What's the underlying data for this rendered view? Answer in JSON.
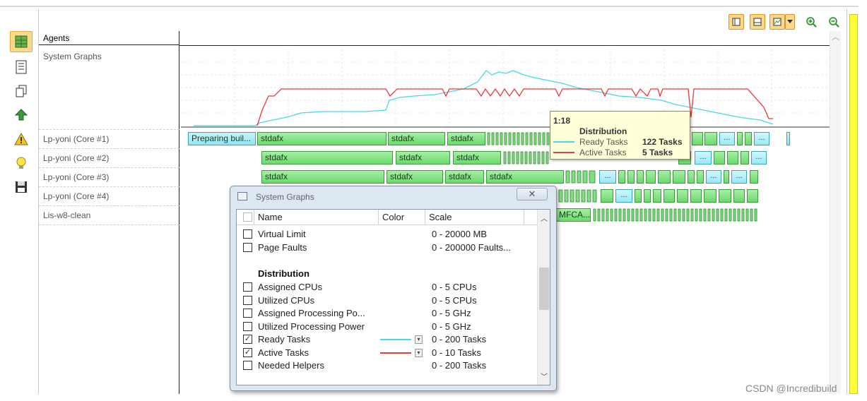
{
  "agents_header": "Agents",
  "rows": [
    {
      "name": "System Graphs"
    },
    {
      "name": "Lp-yoni (Core #1)"
    },
    {
      "name": "Lp-yoni (Core #2)"
    },
    {
      "name": "Lp-yoni (Core #3)"
    },
    {
      "name": "Lp-yoni (Core #4)"
    },
    {
      "name": "Lis-w8-clean"
    }
  ],
  "tasks": {
    "core1": {
      "first": "Preparing buil...",
      "a": "stdafx",
      "b": "stdafx",
      "c": "stdafx"
    },
    "core2": {
      "a": "stdafx",
      "b": "stdafx",
      "c": "stdafx"
    },
    "core3": {
      "a": "stdafx",
      "b": "stdafx",
      "c": "stdafx",
      "d": "stdafx"
    },
    "lis": {
      "a": "MFCA..."
    },
    "dots": "..."
  },
  "tooltip": {
    "time": "1:18",
    "title": "Distribution",
    "rows": [
      {
        "label": "Ready Tasks",
        "value": "122 Tasks",
        "color": "#45d8e8"
      },
      {
        "label": "Active Tasks",
        "value": "5 Tasks",
        "color": "#e83a3a"
      }
    ]
  },
  "dialog": {
    "title": "System Graphs",
    "close": "✕",
    "columns": {
      "name": "Name",
      "color": "Color",
      "scale": "Scale"
    },
    "rows": [
      {
        "name": "Virtual Limit",
        "scale": "0 - 20000 MB",
        "checked": false
      },
      {
        "name": "Page Faults",
        "scale": "0 - 200000 Faults...",
        "checked": false
      },
      {
        "section": "Distribution"
      },
      {
        "name": "Assigned CPUs",
        "scale": "0 - 5 CPUs",
        "checked": false
      },
      {
        "name": "Utilized CPUs",
        "scale": "0 - 5 CPUs",
        "checked": false
      },
      {
        "name": "Assigned Processing Po...",
        "scale": "0 - 5 GHz",
        "checked": false
      },
      {
        "name": "Utilized Processing Power",
        "scale": "0 - 5 GHz",
        "checked": false
      },
      {
        "name": "Ready Tasks",
        "scale": "0 - 200 Tasks",
        "checked": true,
        "color": "#45d8e8"
      },
      {
        "name": "Active Tasks",
        "scale": "0 - 10 Tasks",
        "checked": true,
        "color": "#e83a3a"
      },
      {
        "name": "Needed Helpers",
        "scale": "0 - 200 Tasks",
        "checked": false
      }
    ],
    "check_mark": "✓",
    "dropdown_glyph": "▾"
  },
  "colors": {
    "ready": "#45d8e8",
    "active": "#e83a3a",
    "accent": "#fbd98a"
  },
  "icons": {
    "left_toolbar": [
      "agents-grid-icon",
      "list-view-icon",
      "copy-icon",
      "upload-icon",
      "warning-icon",
      "lightbulb-icon",
      "save-icon"
    ],
    "top_toolbar": [
      "single-pane-icon",
      "split-pane-icon",
      "graph-icon",
      "dropdown-arrow-icon",
      "zoom-in-icon",
      "zoom-out-icon"
    ]
  },
  "scroll_arrows": {
    "up": "︿",
    "down": "﹀"
  },
  "watermark": "CSDN @Incredibuild"
}
